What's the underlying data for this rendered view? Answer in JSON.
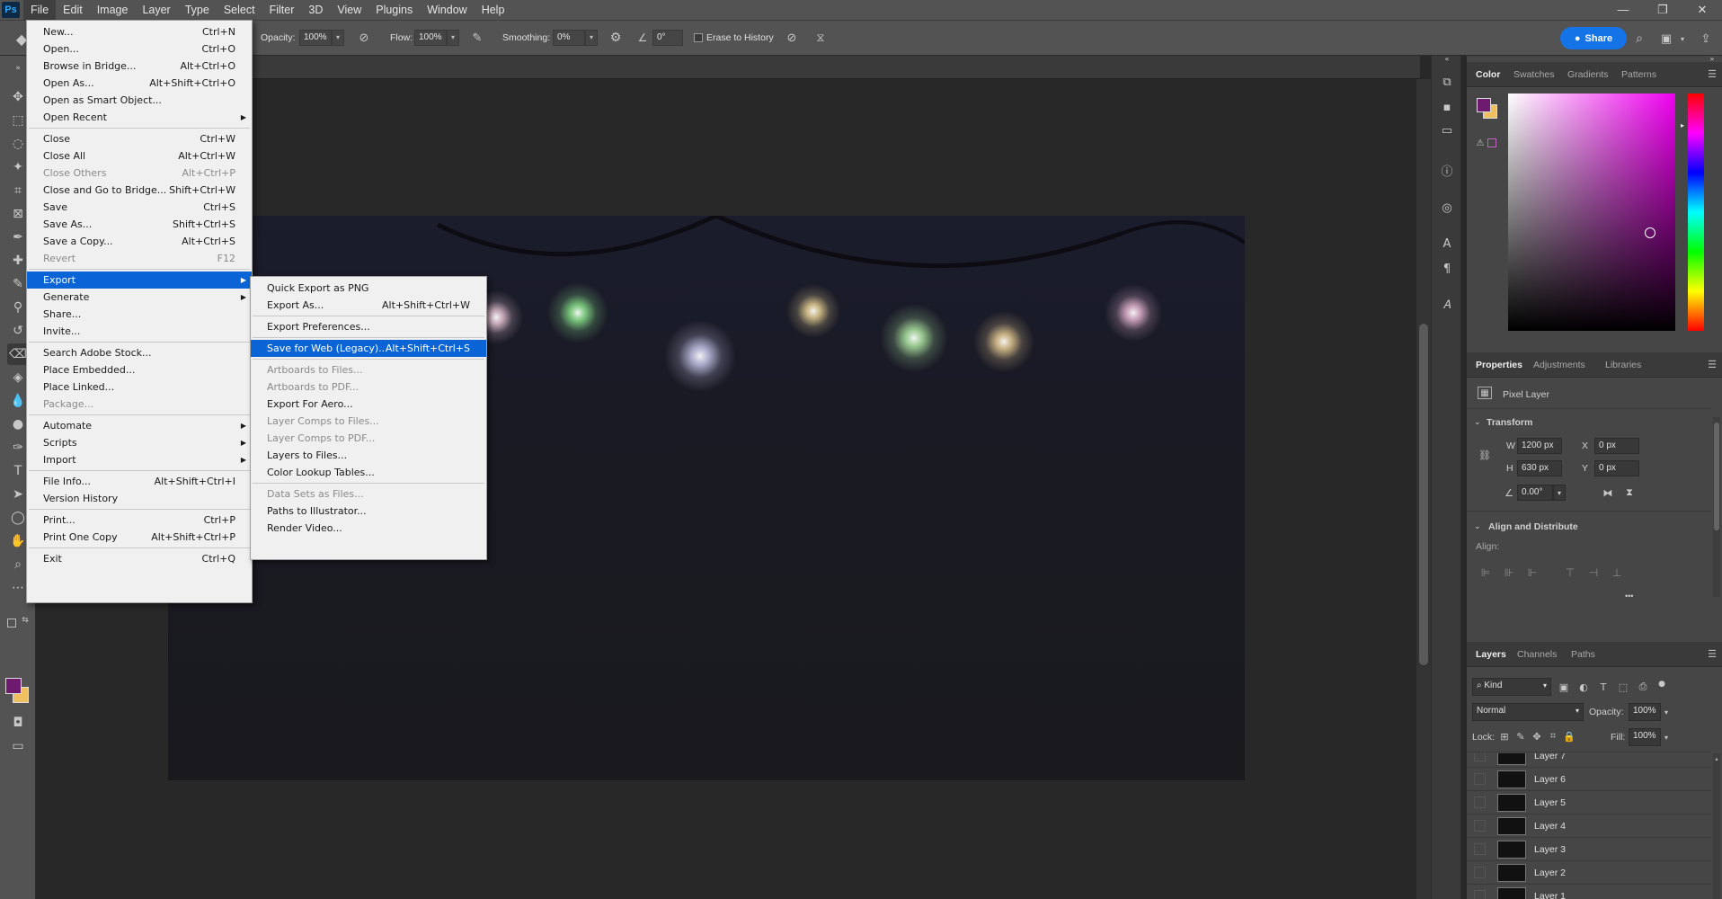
{
  "app": {
    "logo": "Ps"
  },
  "menubar": {
    "items": [
      "File",
      "Edit",
      "Image",
      "Layer",
      "Type",
      "Select",
      "Filter",
      "3D",
      "View",
      "Plugins",
      "Window",
      "Help"
    ],
    "window_controls": [
      "—",
      "❐",
      "✕"
    ]
  },
  "options": {
    "opacity_label": "Opacity:",
    "opacity_value": "100%",
    "flow_label": "Flow:",
    "flow_value": "100%",
    "smoothing_label": "Smoothing:",
    "smoothing_value": "0%",
    "angle_value": "0°",
    "erase_history_label": "Erase to History",
    "share_label": "Share"
  },
  "file_menu": [
    {
      "label": "New...",
      "shortcut": "Ctrl+N"
    },
    {
      "label": "Open...",
      "shortcut": "Ctrl+O"
    },
    {
      "label": "Browse in Bridge...",
      "shortcut": "Alt+Ctrl+O"
    },
    {
      "label": "Open As...",
      "shortcut": "Alt+Shift+Ctrl+O"
    },
    {
      "label": "Open as Smart Object...",
      "shortcut": ""
    },
    {
      "label": "Open Recent",
      "shortcut": "",
      "submenu": true
    },
    {
      "sep": true
    },
    {
      "label": "Close",
      "shortcut": "Ctrl+W"
    },
    {
      "label": "Close All",
      "shortcut": "Alt+Ctrl+W"
    },
    {
      "label": "Close Others",
      "shortcut": "Alt+Ctrl+P",
      "disabled": true
    },
    {
      "label": "Close and Go to Bridge...",
      "shortcut": "Shift+Ctrl+W"
    },
    {
      "label": "Save",
      "shortcut": "Ctrl+S"
    },
    {
      "label": "Save As...",
      "shortcut": "Shift+Ctrl+S"
    },
    {
      "label": "Save a Copy...",
      "shortcut": "Alt+Ctrl+S"
    },
    {
      "label": "Revert",
      "shortcut": "F12",
      "disabled": true
    },
    {
      "sep": true
    },
    {
      "label": "Export",
      "shortcut": "",
      "submenu": true,
      "highlight": true
    },
    {
      "label": "Generate",
      "shortcut": "",
      "submenu": true
    },
    {
      "label": "Share...",
      "shortcut": ""
    },
    {
      "label": "Invite...",
      "shortcut": ""
    },
    {
      "sep": true
    },
    {
      "label": "Search Adobe Stock...",
      "shortcut": ""
    },
    {
      "label": "Place Embedded...",
      "shortcut": ""
    },
    {
      "label": "Place Linked...",
      "shortcut": ""
    },
    {
      "label": "Package...",
      "shortcut": "",
      "disabled": true
    },
    {
      "sep": true
    },
    {
      "label": "Automate",
      "shortcut": "",
      "submenu": true
    },
    {
      "label": "Scripts",
      "shortcut": "",
      "submenu": true
    },
    {
      "label": "Import",
      "shortcut": "",
      "submenu": true
    },
    {
      "sep": true
    },
    {
      "label": "File Info...",
      "shortcut": "Alt+Shift+Ctrl+I"
    },
    {
      "label": "Version History",
      "shortcut": ""
    },
    {
      "sep": true
    },
    {
      "label": "Print...",
      "shortcut": "Ctrl+P"
    },
    {
      "label": "Print One Copy",
      "shortcut": "Alt+Shift+Ctrl+P"
    },
    {
      "sep": true
    },
    {
      "label": "Exit",
      "shortcut": "Ctrl+Q"
    }
  ],
  "export_menu": [
    {
      "label": "Quick Export as PNG",
      "shortcut": ""
    },
    {
      "label": "Export As...",
      "shortcut": "Alt+Shift+Ctrl+W"
    },
    {
      "sep": true
    },
    {
      "label": "Export Preferences...",
      "shortcut": ""
    },
    {
      "sep": true
    },
    {
      "label": "Save for Web (Legacy)...",
      "shortcut": "Alt+Shift+Ctrl+S",
      "highlight": true
    },
    {
      "sep": true
    },
    {
      "label": "Artboards to Files...",
      "shortcut": "",
      "disabled": true
    },
    {
      "label": "Artboards to PDF...",
      "shortcut": "",
      "disabled": true
    },
    {
      "label": "Export For Aero...",
      "shortcut": ""
    },
    {
      "label": "Layer Comps to Files...",
      "shortcut": "",
      "disabled": true
    },
    {
      "label": "Layer Comps to PDF...",
      "shortcut": "",
      "disabled": true
    },
    {
      "label": "Layers to Files...",
      "shortcut": ""
    },
    {
      "label": "Color Lookup Tables...",
      "shortcut": ""
    },
    {
      "sep": true
    },
    {
      "label": "Data Sets as Files...",
      "shortcut": "",
      "disabled": true
    },
    {
      "label": "Paths to Illustrator...",
      "shortcut": ""
    },
    {
      "label": "Render Video...",
      "shortcut": ""
    }
  ],
  "color_panel": {
    "tabs": [
      "Color",
      "Swatches",
      "Gradients",
      "Patterns"
    ],
    "foreground": "#6e1a6e",
    "background": "#f0c060"
  },
  "properties_panel": {
    "tabs": [
      "Properties",
      "Adjustments",
      "Libraries"
    ],
    "layer_type": "Pixel Layer",
    "transform_label": "Transform",
    "w_label": "W",
    "w_value": "1200 px",
    "h_label": "H",
    "h_value": "630 px",
    "x_label": "X",
    "x_value": "0 px",
    "y_label": "Y",
    "y_value": "0 px",
    "angle_value": "0.00°",
    "align_label": "Align and Distribute",
    "align_sub": "Align:",
    "more": "•••"
  },
  "layers_panel": {
    "tabs": [
      "Layers",
      "Channels",
      "Paths"
    ],
    "filter_kind": "Kind",
    "blend_mode": "Normal",
    "opacity_label": "Opacity:",
    "opacity_value": "100%",
    "lock_label": "Lock:",
    "fill_label": "Fill:",
    "fill_value": "100%",
    "layers": [
      "Layer 7",
      "Layer 6",
      "Layer 5",
      "Layer 4",
      "Layer 3",
      "Layer 2",
      "Layer 1"
    ]
  },
  "canvas_lights": [
    {
      "color": "#ffd8e8"
    },
    {
      "color": "#9aff9a"
    },
    {
      "color": "#d8d8ff"
    },
    {
      "color": "#ffe6a0"
    },
    {
      "color": "#c0ffb0"
    },
    {
      "color": "#ffe0a0"
    },
    {
      "color": "#ffc8e6"
    }
  ]
}
